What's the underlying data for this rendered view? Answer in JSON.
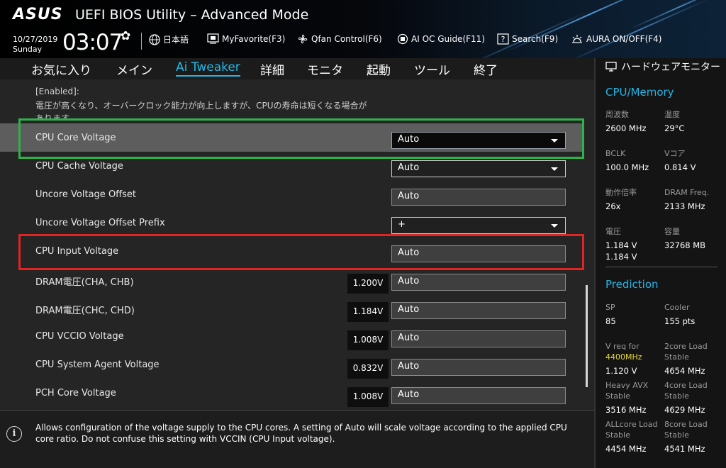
{
  "header": {
    "logo": "ASUS",
    "title": "UEFI BIOS Utility – Advanced Mode",
    "date": "10/27/2019",
    "day": "Sunday",
    "time": "03:07",
    "items": [
      {
        "label": "日本語",
        "icon": "globe-icon"
      },
      {
        "label": "MyFavorite(F3)",
        "icon": "favorite-icon"
      },
      {
        "label": "Qfan Control(F6)",
        "icon": "fan-icon"
      },
      {
        "label": "AI OC Guide(F11)",
        "icon": "ai-chip-icon"
      },
      {
        "label": "Search(F9)",
        "icon": "search-icon"
      },
      {
        "label": "AURA ON/OFF(F4)",
        "icon": "aura-icon"
      }
    ]
  },
  "nav": {
    "tabs": [
      "お気に入り",
      "メイン",
      "Ai Tweaker",
      "詳細",
      "モニタ",
      "起動",
      "ツール",
      "終了"
    ],
    "active": "Ai Tweaker"
  },
  "main": {
    "desc_lines": [
      "[Enabled]:",
      "電圧が高くなり、オーバークロック能力が向上しますが、CPUの寿命は短くなる場合が",
      "あります。"
    ],
    "rows": [
      {
        "label": "CPU Core Voltage",
        "value": "Auto",
        "type": "dropdown",
        "selected": true
      },
      {
        "label": "CPU Cache Voltage",
        "value": "Auto",
        "type": "dropdown"
      },
      {
        "label": "Uncore Voltage Offset",
        "value": "Auto",
        "type": "input"
      },
      {
        "label": "Uncore Voltage Offset Prefix",
        "value": "+",
        "type": "dropdown"
      },
      {
        "label": "CPU Input Voltage",
        "value": "Auto",
        "type": "input"
      },
      {
        "label": "DRAM電圧(CHA, CHB)",
        "value": "Auto",
        "type": "input",
        "current": "1.200V"
      },
      {
        "label": "DRAM電圧(CHC, CHD)",
        "value": "Auto",
        "type": "input",
        "current": "1.184V"
      },
      {
        "label": "CPU VCCIO Voltage",
        "value": "Auto",
        "type": "input",
        "current": "1.008V"
      },
      {
        "label": "CPU System Agent Voltage",
        "value": "Auto",
        "type": "input",
        "current": "0.832V"
      },
      {
        "label": "PCH Core Voltage",
        "value": "Auto",
        "type": "input",
        "current": "1.008V"
      }
    ],
    "highlight_colors": {
      "green": "#2eb34a",
      "red": "#e02323"
    }
  },
  "help": {
    "text": "Allows configuration of the voltage supply to the CPU cores. A setting of Auto will scale voltage according to the applied CPU core ratio.  Do not confuse this setting with VCCIN (CPU Input voltage)."
  },
  "monitor": {
    "title": "ハードウェアモニター",
    "cpu_section": "CPU/Memory",
    "cpu_items": [
      {
        "label": "周波数",
        "value": "2600 MHz"
      },
      {
        "label": "温度",
        "value": "29°C"
      },
      {
        "label": "BCLK",
        "value": "100.0 MHz"
      },
      {
        "label": "Vコア",
        "value": "0.814 V"
      },
      {
        "label": "動作倍率",
        "value": "26x"
      },
      {
        "label": "DRAM Freq.",
        "value": "2133 MHz"
      },
      {
        "label": "電圧",
        "value": "1.184 V",
        "value2": "1.184 V"
      },
      {
        "label": "容量",
        "value": "32768 MB"
      }
    ],
    "pred_section": "Prediction",
    "pred_items": [
      {
        "label": "SP",
        "value": "85"
      },
      {
        "label": "Cooler",
        "value": "155 pts"
      },
      {
        "label": "V req for",
        "label2": "4400MHz",
        "value": "1.120 V"
      },
      {
        "label": "2core Load",
        "label2": "Stable",
        "value": "4654 MHz"
      },
      {
        "label": "Heavy AVX",
        "label2": "Stable",
        "value": "3516 MHz"
      },
      {
        "label": "4core Load",
        "label2": "Stable",
        "value": "4629 MHz"
      },
      {
        "label": "ALLcore Load",
        "label2": "Stable",
        "value": "4454 MHz"
      },
      {
        "label": "8core Load",
        "label2": "Stable",
        "value": "4541 MHz"
      }
    ]
  }
}
